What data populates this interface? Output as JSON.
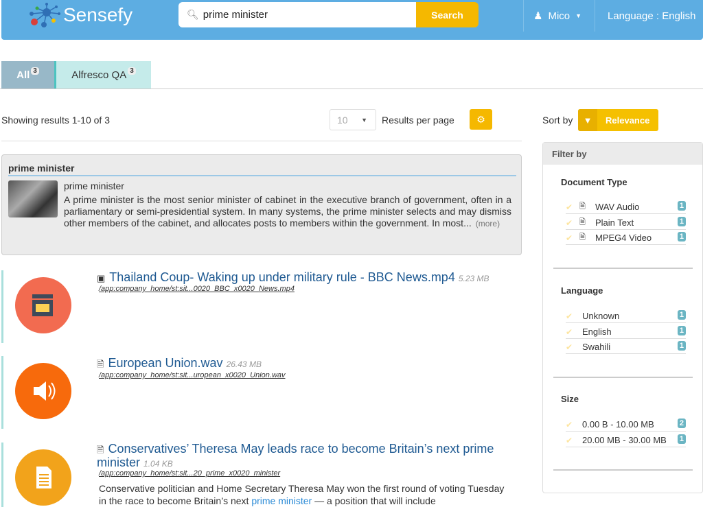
{
  "header": {
    "brand": "Sensefy",
    "search_value": "prime minister",
    "search_button": "Search",
    "user": "Mico",
    "language": "Language : English"
  },
  "tabs": [
    {
      "label": "All",
      "count": "3"
    },
    {
      "label": "Alfresco QA",
      "count": "3"
    }
  ],
  "toolbar": {
    "showing": "Showing results 1-10 of 3",
    "per_page": "10",
    "results_per_page": "Results per page",
    "sort_by": "Sort by",
    "sort_value": "Relevance"
  },
  "definition": {
    "title": "prime minister",
    "heading": "prime minister",
    "body": "A prime minister is the most senior minister of cabinet in the executive branch of government, often in a parliamentary or semi-presidential system. In many systems, the prime minister selects and may dismiss other members of the cabinet, and allocates posts to members within the government. In most...",
    "more": "(more)"
  },
  "results": [
    {
      "title": "Thailand Coup- Waking up under military rule - BBC News.mp4",
      "size": "5.23 MB",
      "path": "/app:company_home/st:sit...0020_BBC_x0020_News.mp4",
      "icon": "video-clapper-icon",
      "color": "#f26b50"
    },
    {
      "title": "European Union.wav",
      "size": "26.43 MB",
      "path": "/app:company_home/st:sit...uropean_x0020_Union.wav",
      "icon": "speaker-icon",
      "color": "#f76a0c"
    },
    {
      "title": "Conservatives’ Theresa May leads race to become Britain’s next prime minister",
      "size": "1.04 KB",
      "path": "/app:company_home/st:sit...20_prime_x0020_minister",
      "icon": "document-icon",
      "color": "#f2a31b",
      "snippet_pre": "Conservative politician and Home Secretary Theresa May won the first round of voting Tuesday in the race to become Britain’s next ",
      "snippet_hl": "prime minister",
      "snippet_post": " — a position that will include"
    }
  ],
  "filter": {
    "title": "Filter by",
    "doc_type": {
      "label": "Document Type",
      "items": [
        {
          "label": "WAV Audio",
          "count": "1"
        },
        {
          "label": "Plain Text",
          "count": "1"
        },
        {
          "label": "MPEG4 Video",
          "count": "1"
        }
      ]
    },
    "language": {
      "label": "Language",
      "items": [
        {
          "label": "Unknown",
          "count": "1"
        },
        {
          "label": "English",
          "count": "1"
        },
        {
          "label": "Swahili",
          "count": "1"
        }
      ]
    },
    "size": {
      "label": "Size",
      "items": [
        {
          "label": "0.00 B - 10.00 MB",
          "count": "2"
        },
        {
          "label": "20.00 MB - 30.00 MB",
          "count": "1"
        }
      ]
    }
  },
  "colors": {
    "header": "#5dade2",
    "accent": "#f5b800",
    "badge": "#6bb5c3",
    "link": "#1f5a92"
  }
}
